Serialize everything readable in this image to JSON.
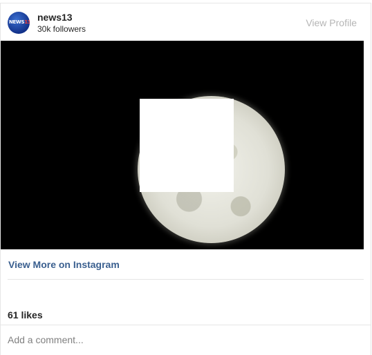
{
  "header": {
    "avatar_logo_text": "NEWS",
    "avatar_logo_num": "13",
    "username": "news13",
    "followers": "30k followers",
    "view_profile_label": "View Profile"
  },
  "post": {
    "image_subject": "full-moon-photo",
    "view_more_label": "View More on Instagram",
    "likes": "61 likes",
    "comment_placeholder": "Add a comment..."
  },
  "colors": {
    "link": "#3a5f8f",
    "muted": "#b5b5b5",
    "text": "#262626",
    "divider": "#e6e6e6"
  }
}
